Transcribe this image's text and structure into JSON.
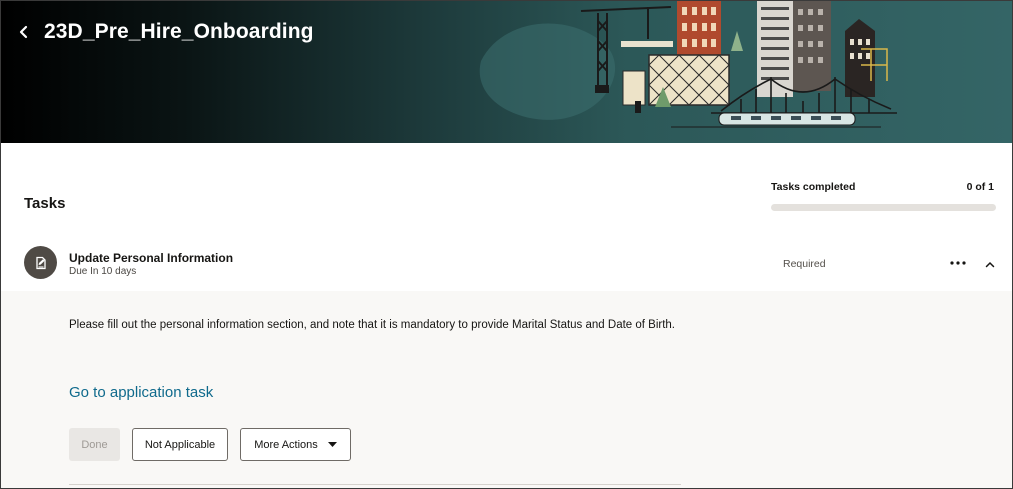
{
  "header": {
    "title": "23D_Pre_Hire_Onboarding",
    "back_icon": "chevron-left-icon"
  },
  "tasks_section": {
    "heading": "Tasks",
    "progress": {
      "label": "Tasks completed",
      "count_text": "0 of 1",
      "completed": 0,
      "total": 1
    }
  },
  "task": {
    "icon": "edit-document-icon",
    "title": "Update Personal Information",
    "due": "Due In 10 days",
    "status": "Required",
    "description": "Please fill out the personal information section, and note that it is mandatory to provide Marital Status and Date of Birth.",
    "link_label": "Go to application task",
    "buttons": {
      "done": "Done",
      "not_applicable": "Not Applicable",
      "more_actions": "More Actions"
    }
  },
  "colors": {
    "accent": "#227e9e",
    "link": "#0f6a8c",
    "banner_teal": "#346566"
  }
}
